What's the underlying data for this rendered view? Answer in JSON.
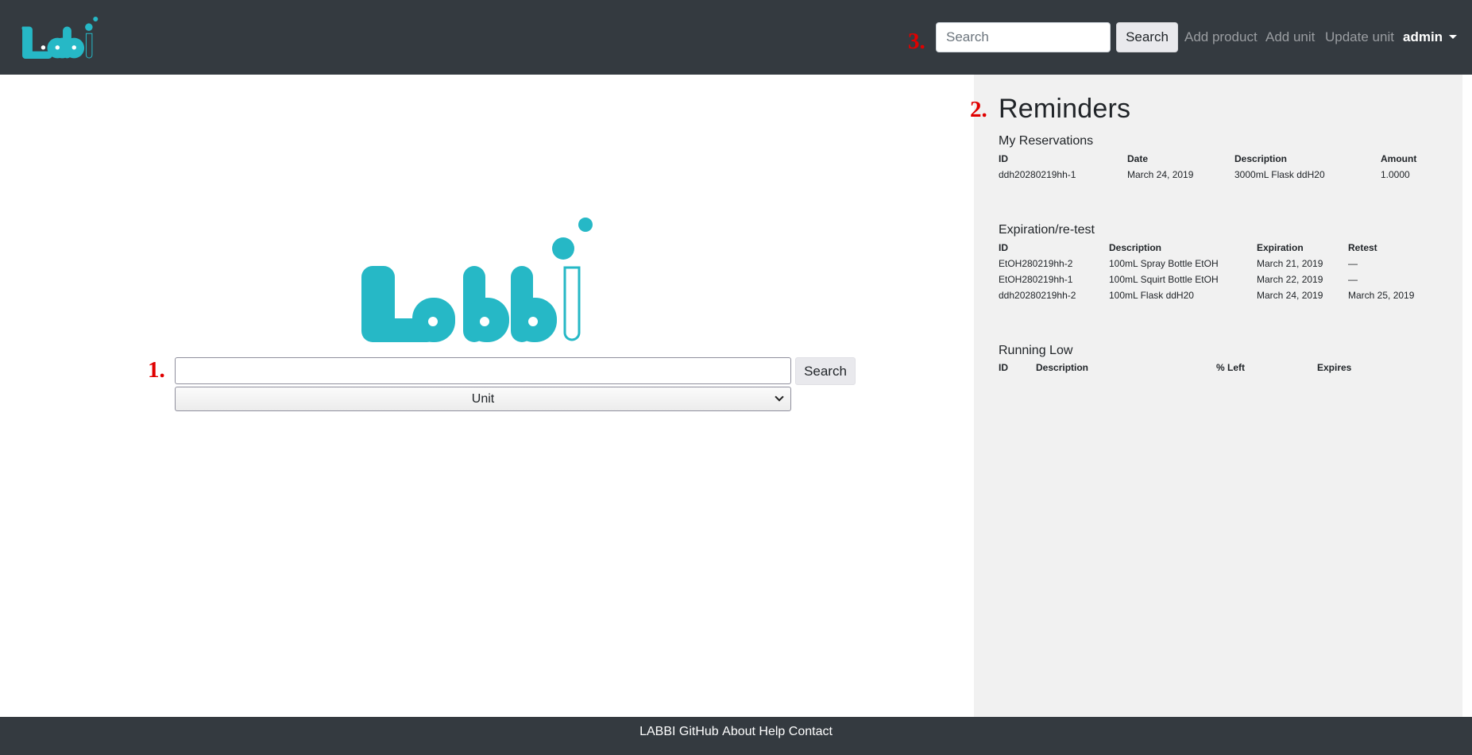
{
  "header": {
    "logo_text": "Labbi",
    "annotation": "3.",
    "search_placeholder": "Search",
    "search_button": "Search",
    "links": [
      "Add product",
      "Add unit",
      "Update unit"
    ],
    "user": "admin"
  },
  "main": {
    "logo_text": "Labbi",
    "annotation": "1.",
    "search_value": "",
    "search_button": "Search",
    "unit_select": "Unit"
  },
  "sidebar": {
    "annotation": "2.",
    "title": "Reminders",
    "reservations": {
      "title": "My Reservations",
      "headers": [
        "ID",
        "Date",
        "Description",
        "Amount"
      ],
      "rows": [
        [
          "ddh20280219hh-1",
          "March 24, 2019",
          "3000mL Flask ddH20",
          "1.0000"
        ]
      ]
    },
    "expiration": {
      "title": "Expiration/re-test",
      "headers": [
        "ID",
        "Description",
        "Expiration",
        "Retest"
      ],
      "rows": [
        [
          "EtOH280219hh-2",
          "100mL Spray Bottle EtOH",
          "March 21, 2019",
          "—"
        ],
        [
          "EtOH280219hh-1",
          "100mL Squirt Bottle EtOH",
          "March 22, 2019",
          "—"
        ],
        [
          "ddh20280219hh-2",
          "100mL Flask ddH20",
          "March 24, 2019",
          "March 25, 2019"
        ]
      ]
    },
    "running_low": {
      "title": "Running Low",
      "headers": [
        "ID",
        "Description",
        "% Left",
        "Expires"
      ],
      "rows": []
    }
  },
  "footer": {
    "links": [
      "LABBI",
      "GitHub",
      "About",
      "Help",
      "Contact"
    ]
  },
  "colors": {
    "brand_teal": "#26b8c6",
    "navbar": "#343a40",
    "annotation_red": "#e00000",
    "sidebar_bg": "#f1f1f1"
  }
}
